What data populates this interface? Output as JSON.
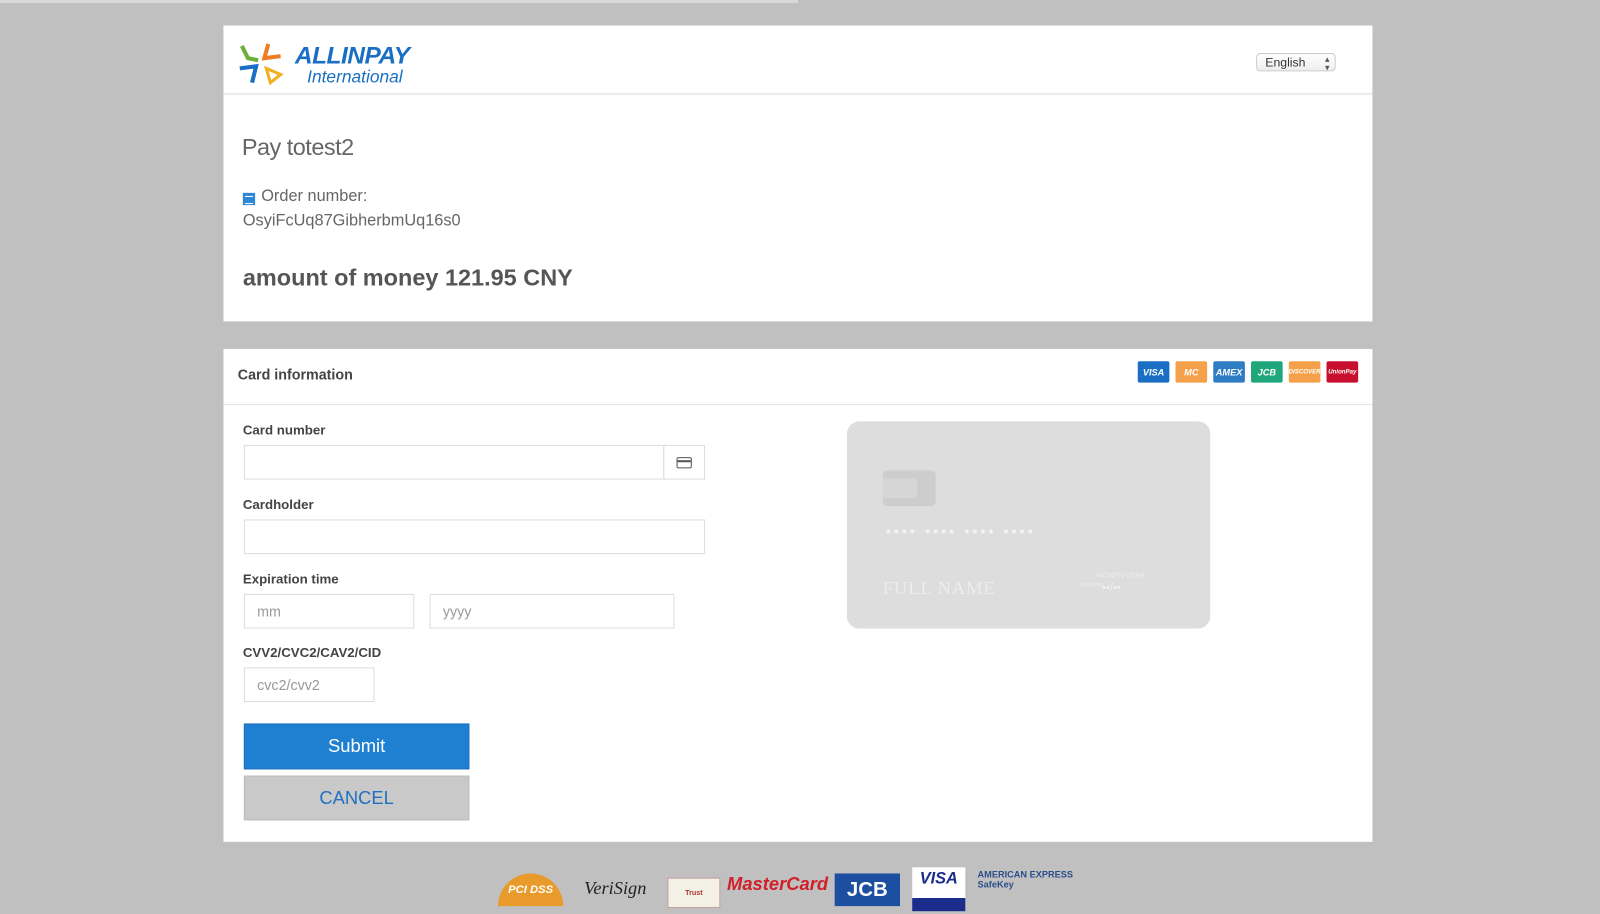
{
  "header": {
    "logo": {
      "name": "ALLINPAY",
      "sub": "International"
    },
    "language": {
      "selected": "English"
    }
  },
  "order": {
    "title": "Pay totest2",
    "order_label": "Order number:",
    "order_number": "OsyiFcUq87GibherbmUq16s0",
    "amount": "amount of money 121.95 CNY"
  },
  "card": {
    "title": "Card information",
    "brands": [
      {
        "name": "VISA",
        "color": "#1a6fc4"
      },
      {
        "name": "MC",
        "color": "#f5a04a"
      },
      {
        "name": "AMEX",
        "color": "#2e7cc4"
      },
      {
        "name": "JCB",
        "color": "#1fa67a"
      },
      {
        "name": "DISCOVER",
        "color": "#f5a04a"
      },
      {
        "name": "UnionPay",
        "color": "#c8102e"
      }
    ],
    "fields": {
      "card_number_label": "Card number",
      "cardholder_label": "Cardholder",
      "expiration_label": "Expiration time",
      "month_placeholder": "mm",
      "year_placeholder": "yyyy",
      "cvv_label": "CVV2/CVC2/CAV2/CID",
      "cvv_placeholder": "cvc2/cvv2"
    },
    "submit_label": "Submit",
    "cancel_label": "CANCEL",
    "preview": {
      "number": "•••• •••• •••• ••••",
      "name": "FULL NAME",
      "month_year": "MONTH/YEAR",
      "valid_thru": "valid thru",
      "expiry": "••/••"
    }
  },
  "footer": {
    "logos": [
      "PCI DSS",
      "VeriSign",
      "Trust",
      "MasterCard",
      "JCB",
      "VISA",
      "AMERICAN EXPRESS SafeKey"
    ]
  },
  "colors": {
    "accent": "#1f80d1",
    "background": "#c0c0c0"
  }
}
